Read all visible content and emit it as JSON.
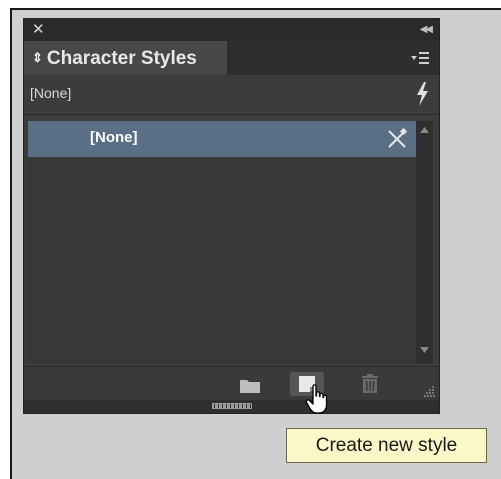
{
  "panel": {
    "title": "Character Styles",
    "current_style": "[None]"
  },
  "styles_list": {
    "items": [
      {
        "label": "[None]",
        "selected": true
      }
    ]
  },
  "tooltip": {
    "text": "Create new style"
  },
  "icons": {
    "close": "close-icon",
    "collapse": "double-chevron-left-icon",
    "panel_menu": "panel-menu-icon",
    "clear_overrides": "lightning-icon",
    "edit": "pencil-crossed-icon",
    "folder": "folder-icon",
    "new_style": "new-page-icon",
    "trash": "trash-icon"
  },
  "colors": {
    "selection": "#5a6f86",
    "panel_bg": "#3c3c3c",
    "tooltip_bg": "#fbf7c9"
  }
}
